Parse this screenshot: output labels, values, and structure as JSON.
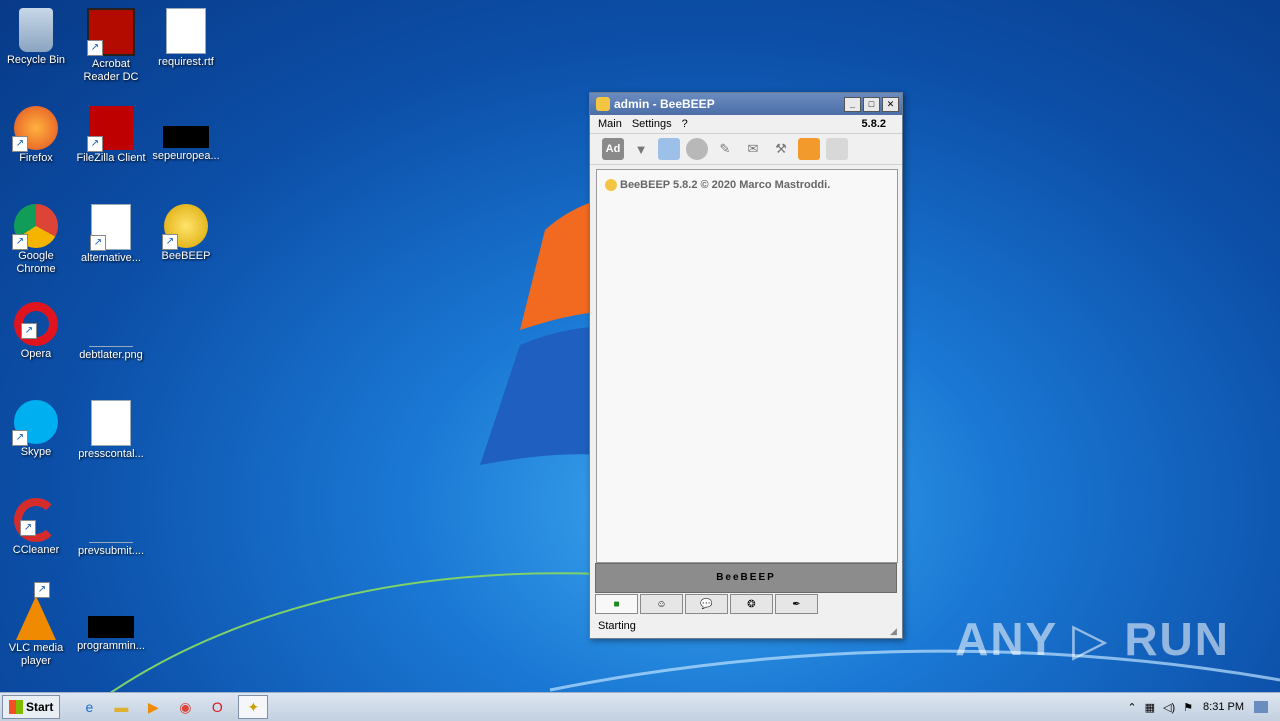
{
  "desktop": {
    "icons": [
      {
        "label": "Recycle Bin",
        "name": "recycle-bin-icon",
        "glyph": "🗑"
      },
      {
        "label": "Acrobat Reader DC",
        "name": "acrobat-reader-icon",
        "glyph": "A"
      },
      {
        "label": "requirest.rtf",
        "name": "word-document-icon",
        "glyph": "W"
      },
      {
        "label": "Firefox",
        "name": "firefox-icon",
        "glyph": "🦊"
      },
      {
        "label": "FileZilla Client",
        "name": "filezilla-icon",
        "glyph": "Z"
      },
      {
        "label": "sepeuropea...",
        "name": "file-icon",
        "glyph": ""
      },
      {
        "label": "Google Chrome",
        "name": "chrome-icon",
        "glyph": "◉"
      },
      {
        "label": "alternative...",
        "name": "word-document-icon",
        "glyph": "W"
      },
      {
        "label": "BeeBEEP",
        "name": "beebeep-icon",
        "glyph": "🐝"
      },
      {
        "label": "Opera",
        "name": "opera-icon",
        "glyph": "O"
      },
      {
        "label": "debtlater.png",
        "name": "image-file-icon",
        "glyph": ""
      },
      {
        "label": "Skype",
        "name": "skype-icon",
        "glyph": "S"
      },
      {
        "label": "presscontal...",
        "name": "word-document-icon",
        "glyph": "W"
      },
      {
        "label": "CCleaner",
        "name": "ccleaner-icon",
        "glyph": "C"
      },
      {
        "label": "prevsubmit....",
        "name": "file-icon",
        "glyph": ""
      },
      {
        "label": "VLC media player",
        "name": "vlc-icon",
        "glyph": "▲"
      },
      {
        "label": "programmin...",
        "name": "file-icon",
        "glyph": ""
      }
    ]
  },
  "window": {
    "title": "admin - BeeBEEP",
    "controls": {
      "minimize": "_",
      "maximize": "□",
      "close": "✕"
    },
    "menu": [
      "Main",
      "Settings",
      "?"
    ],
    "version_badge": "5.8.2",
    "toolbar": {
      "ad_label": "Ad"
    },
    "chat_line": "BeeBEEP 5.8.2 © 2020 Marco Mastroddi.",
    "beebar_text": "BeeBEEP",
    "status": "Starting"
  },
  "taskbar": {
    "start_label": "Start",
    "clock": "8:31 PM"
  },
  "watermark": "ANY ▷ RUN"
}
